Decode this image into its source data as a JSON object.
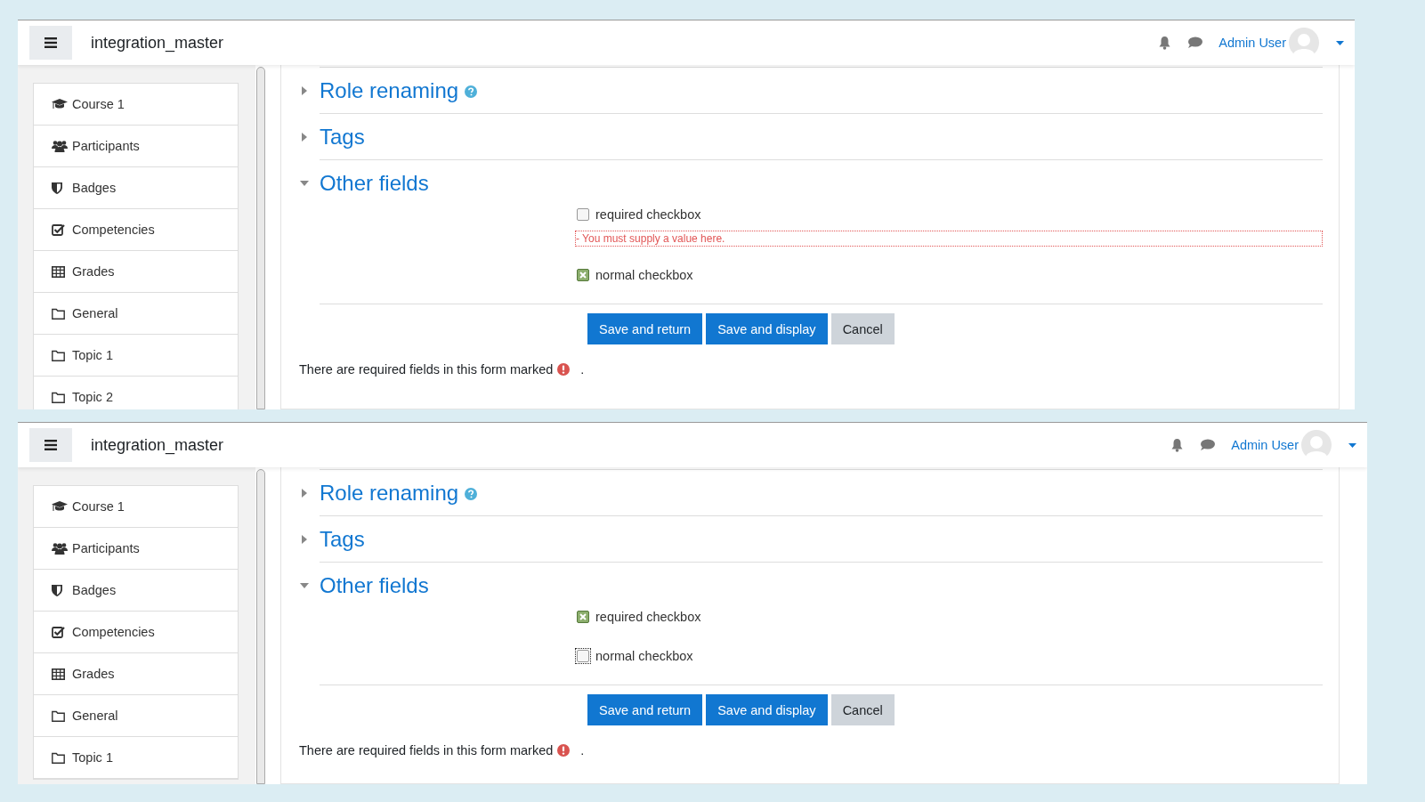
{
  "panels": [
    {
      "header": {
        "site_name": "integration_master",
        "user_name": "Admin User"
      },
      "sidebar": {
        "items": [
          {
            "kind": "course",
            "label": "Course 1"
          },
          {
            "kind": "participants",
            "label": "Participants"
          },
          {
            "kind": "badges",
            "label": "Badges"
          },
          {
            "kind": "competencies",
            "label": "Competencies"
          },
          {
            "kind": "grades",
            "label": "Grades"
          },
          {
            "kind": "section",
            "label": "General"
          },
          {
            "kind": "section",
            "label": "Topic 1"
          },
          {
            "kind": "section",
            "label": "Topic 2"
          }
        ]
      },
      "sections": [
        {
          "title": "Role renaming",
          "expanded": false,
          "help": true
        },
        {
          "title": "Tags",
          "expanded": false,
          "help": false
        },
        {
          "title": "Other fields",
          "expanded": true,
          "help": false
        }
      ],
      "fields": [
        {
          "label": "required checkbox",
          "checked": false,
          "focused": false,
          "error": "- You must supply a value here."
        },
        {
          "label": "normal checkbox",
          "checked": true,
          "focused": false
        }
      ],
      "buttons": [
        {
          "kind": "primary",
          "label": "Save and return"
        },
        {
          "kind": "primary",
          "label": "Save and display"
        },
        {
          "kind": "secondary",
          "label": "Cancel"
        }
      ],
      "note": {
        "text": "There are required fields in this form marked",
        "end": "."
      }
    },
    {
      "header": {
        "site_name": "integration_master",
        "user_name": "Admin User"
      },
      "sidebar": {
        "items": [
          {
            "kind": "course",
            "label": "Course 1"
          },
          {
            "kind": "participants",
            "label": "Participants"
          },
          {
            "kind": "badges",
            "label": "Badges"
          },
          {
            "kind": "competencies",
            "label": "Competencies"
          },
          {
            "kind": "grades",
            "label": "Grades"
          },
          {
            "kind": "section",
            "label": "General"
          },
          {
            "kind": "section",
            "label": "Topic 1"
          }
        ]
      },
      "sections": [
        {
          "title": "Role renaming",
          "expanded": false,
          "help": true
        },
        {
          "title": "Tags",
          "expanded": false,
          "help": false
        },
        {
          "title": "Other fields",
          "expanded": true,
          "help": false
        }
      ],
      "fields": [
        {
          "label": "required checkbox",
          "checked": true,
          "focused": false
        },
        {
          "label": "normal checkbox",
          "checked": false,
          "focused": true
        }
      ],
      "buttons": [
        {
          "kind": "primary",
          "label": "Save and return"
        },
        {
          "kind": "primary",
          "label": "Save and display"
        },
        {
          "kind": "secondary",
          "label": "Cancel"
        }
      ],
      "note": {
        "text": "There are required fields in this form marked",
        "end": "."
      }
    }
  ]
}
